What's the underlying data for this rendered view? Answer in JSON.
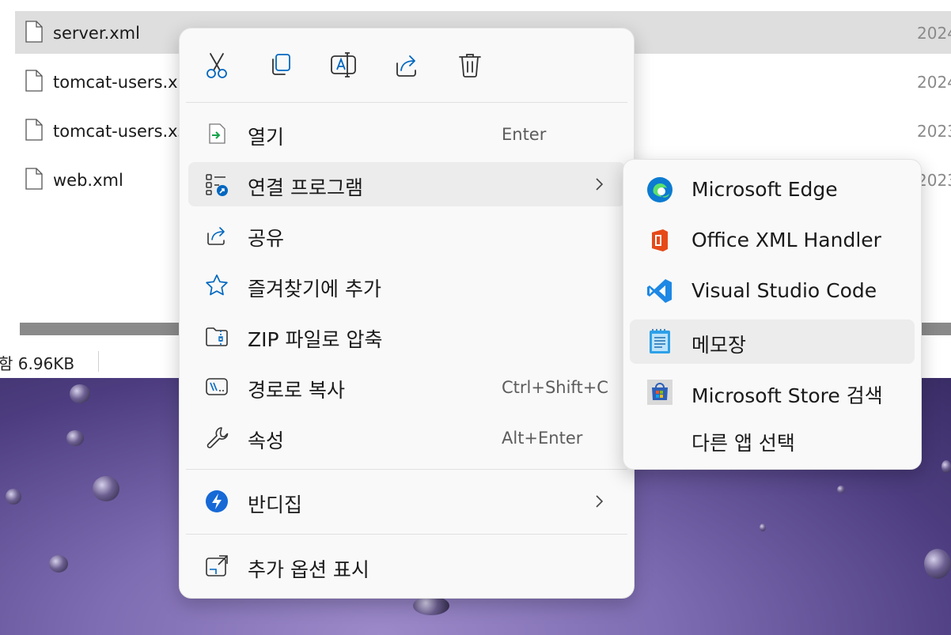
{
  "explorer": {
    "files": [
      {
        "name": "server.xml",
        "date": "2024",
        "selected": true
      },
      {
        "name": "tomcat-users.xml",
        "date": "2024",
        "selected": false
      },
      {
        "name": "tomcat-users.xsd",
        "date": "2023",
        "selected": false
      },
      {
        "name": "web.xml",
        "date": "2023",
        "selected": false
      }
    ],
    "status_text": "함 6.96KB"
  },
  "context_menu": {
    "toolbar": [
      {
        "icon": "cut-icon"
      },
      {
        "icon": "copy-icon"
      },
      {
        "icon": "rename-icon"
      },
      {
        "icon": "share-icon"
      },
      {
        "icon": "delete-icon"
      }
    ],
    "items": [
      {
        "label": "열기",
        "shortcut": "Enter",
        "icon": "open-icon"
      },
      {
        "label": "연결 프로그램",
        "shortcut": "",
        "icon": "open-with-icon",
        "has_submenu": true
      },
      {
        "label": "공유",
        "shortcut": "",
        "icon": "share-icon"
      },
      {
        "label": "즐겨찾기에 추가",
        "shortcut": "",
        "icon": "star-icon"
      },
      {
        "label": "ZIP 파일로 압축",
        "shortcut": "",
        "icon": "zip-folder-icon"
      },
      {
        "label": "경로로 복사",
        "shortcut": "Ctrl+Shift+C",
        "icon": "copy-path-icon"
      },
      {
        "label": "속성",
        "shortcut": "Alt+Enter",
        "icon": "wrench-icon"
      },
      {
        "label": "반디집",
        "shortcut": "",
        "icon": "bandizip-icon",
        "has_submenu": true
      },
      {
        "label": "추가 옵션 표시",
        "shortcut": "",
        "icon": "more-options-icon"
      }
    ]
  },
  "submenu": {
    "items": [
      {
        "label": "Microsoft Edge",
        "icon": "edge-icon"
      },
      {
        "label": "Office XML Handler",
        "icon": "office-icon"
      },
      {
        "label": "Visual Studio Code",
        "icon": "vscode-icon"
      },
      {
        "label": "메모장",
        "icon": "notepad-icon"
      },
      {
        "label": "Microsoft Store 검색",
        "icon": "store-icon"
      },
      {
        "label": "다른 앱 선택",
        "icon": ""
      }
    ]
  },
  "colors": {
    "accent": "#0067c0",
    "menu_bg": "#f9f9f9",
    "hover_bg": "#ececec",
    "selected_row": "#dedede"
  }
}
